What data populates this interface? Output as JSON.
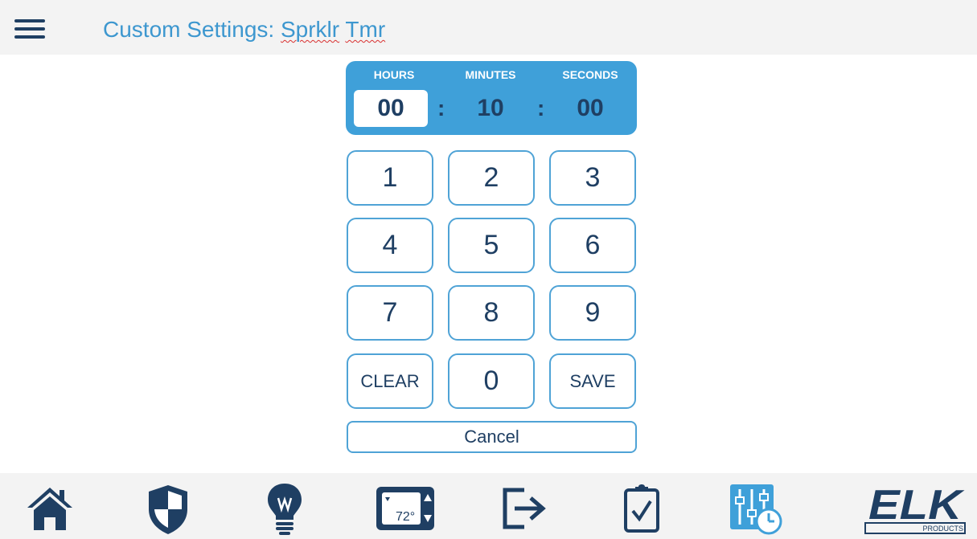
{
  "header": {
    "title_prefix": "Custom Settings: ",
    "title_word1": "Sprklr",
    "title_word2": "Tmr"
  },
  "timer": {
    "labels": {
      "hours": "HOURS",
      "minutes": "MINUTES",
      "seconds": "SECONDS"
    },
    "hours": "00",
    "minutes": "10",
    "seconds": "00",
    "separator": ":",
    "active_field": "hours"
  },
  "keypad": {
    "keys": [
      "1",
      "2",
      "3",
      "4",
      "5",
      "6",
      "7",
      "8",
      "9",
      "CLEAR",
      "0",
      "SAVE"
    ],
    "cancel_label": "Cancel"
  },
  "nav": {
    "items": [
      "home-icon",
      "shield-icon",
      "lightbulb-icon",
      "thermostat-icon",
      "exit-icon",
      "clipboard-check-icon",
      "settings-sliders-clock-icon"
    ],
    "thermostat_temp": "72°",
    "logo_text": "ELK",
    "logo_subtext": "PRODUCTS"
  },
  "colors": {
    "accent": "#3fa0d9",
    "dark": "#1f3f63",
    "header_bg": "#f3f3f3",
    "title": "#3d97cf",
    "active_nav_icon": "#3fa0d9"
  }
}
